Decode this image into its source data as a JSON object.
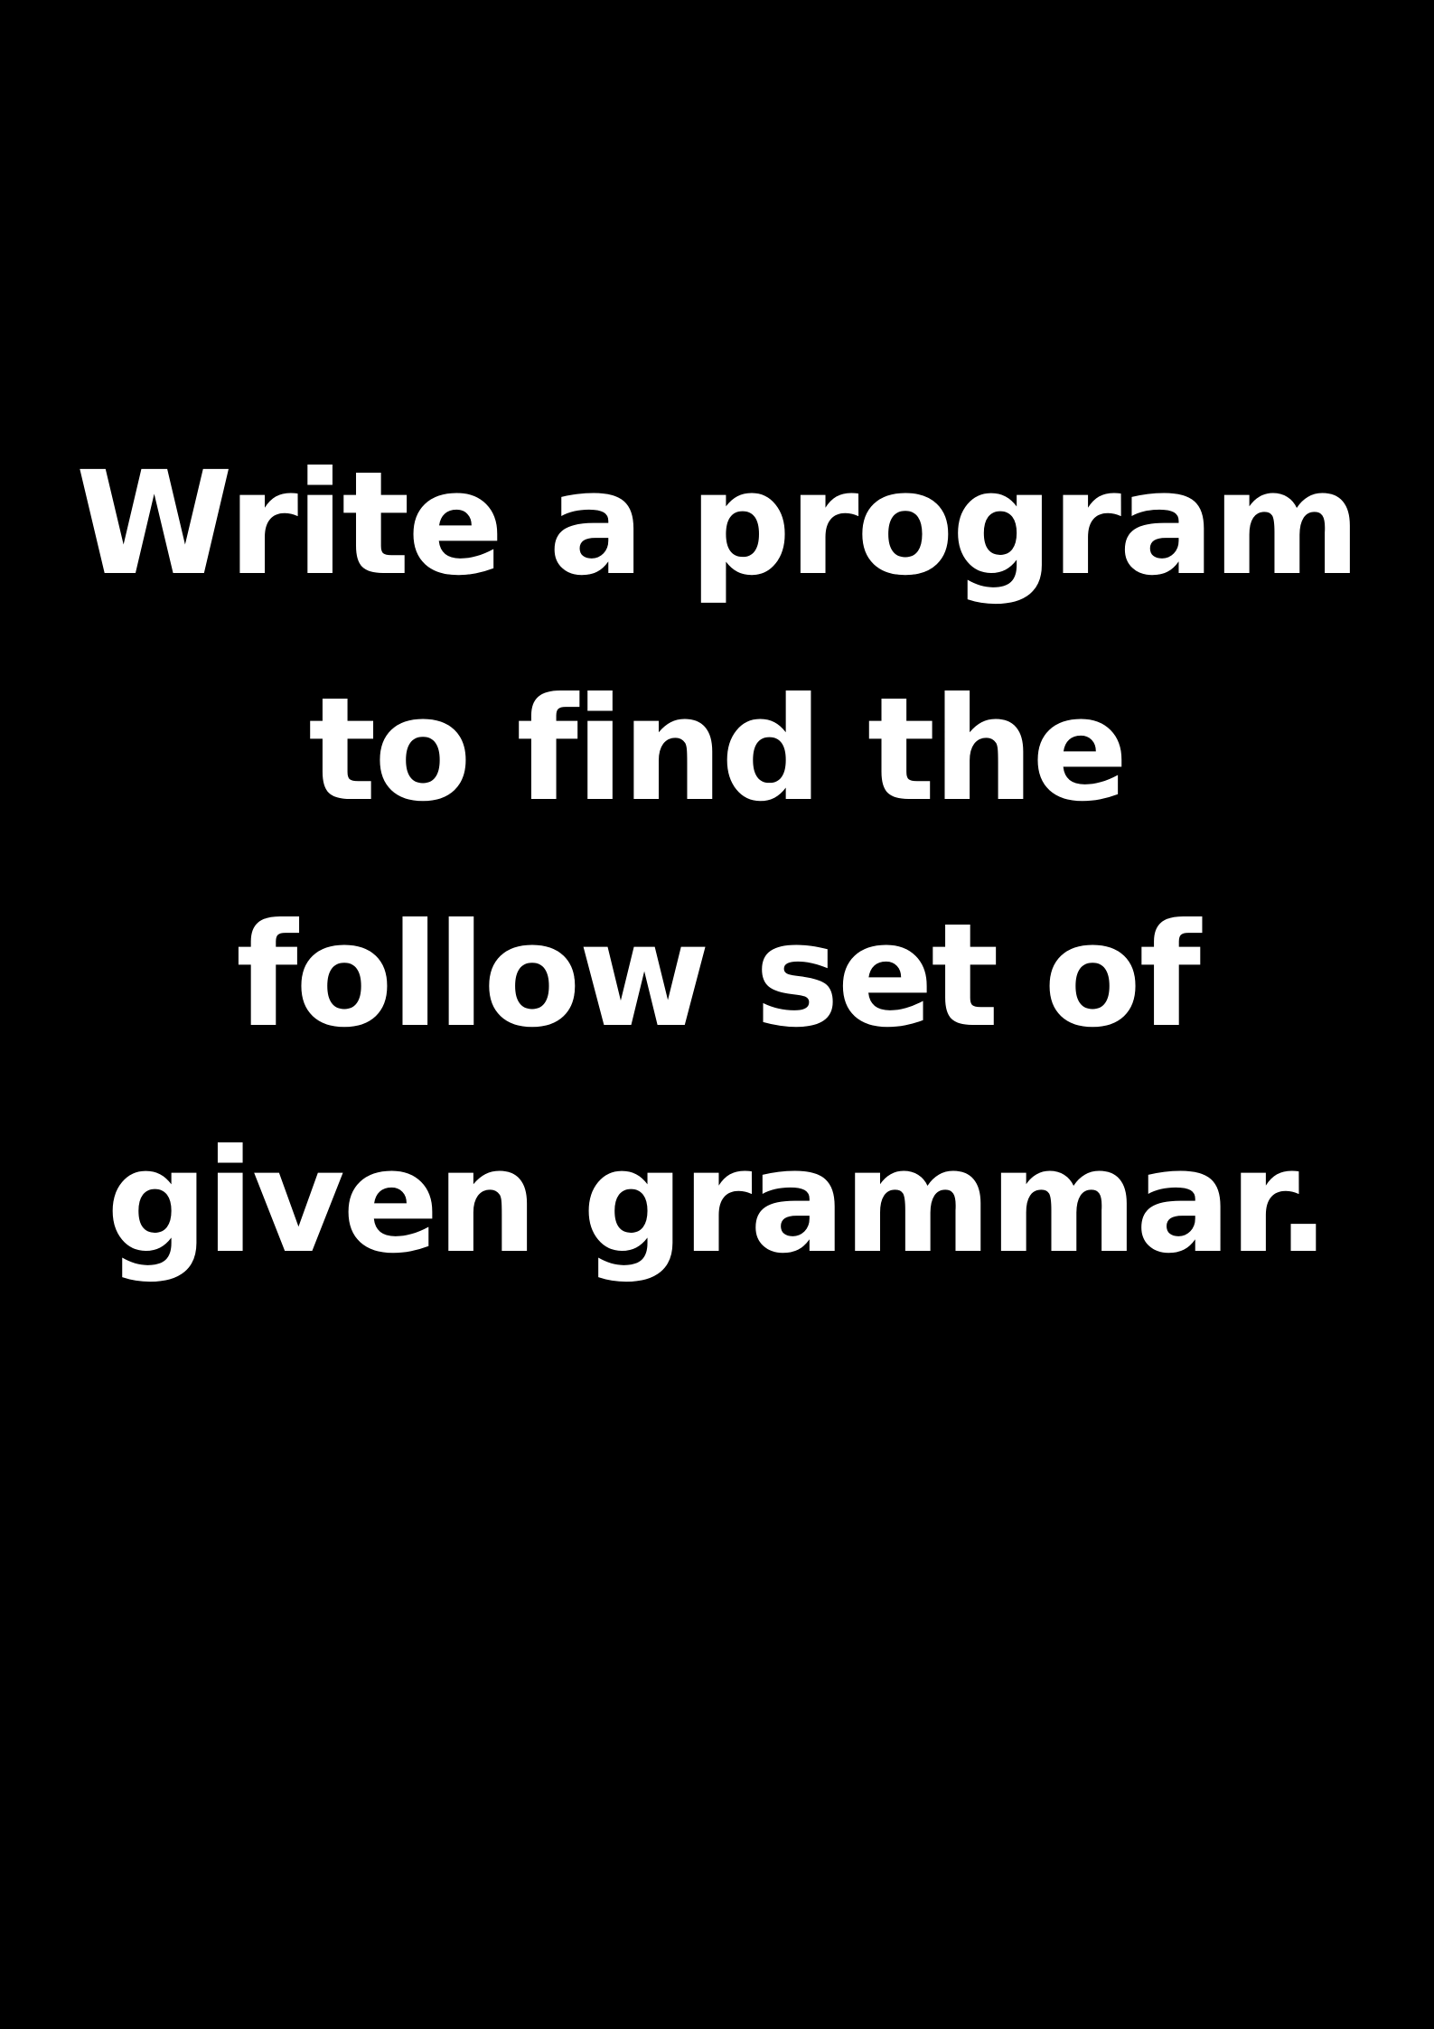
{
  "poster": {
    "background_color": "#000000",
    "text_color": "#ffffff",
    "lines": [
      "Write a program",
      "to find the",
      "follow set of",
      "given grammar."
    ]
  }
}
